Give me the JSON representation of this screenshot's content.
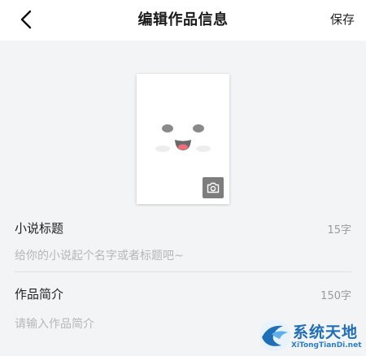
{
  "header": {
    "title": "编辑作品信息",
    "save_label": "保存"
  },
  "cover": {
    "icons": [
      "smiley-face-icon",
      "camera-icon"
    ]
  },
  "form": {
    "novel_title": {
      "label": "小说标题",
      "limit": "15字",
      "placeholder": "给你的小说起个名字或者标题吧~",
      "value": ""
    },
    "intro": {
      "label": "作品简介",
      "limit": "150字",
      "placeholder": "请输入作品简介",
      "value": ""
    }
  },
  "watermark": {
    "title": "系统天地",
    "url": "XiTongTianDi.net"
  },
  "colors": {
    "background": "#f2f4f5",
    "header_bg": "#ffffff",
    "placeholder": "#b7b7b7",
    "camera_button": "#7d7d7d",
    "watermark_blue": "#1f6fb8"
  }
}
